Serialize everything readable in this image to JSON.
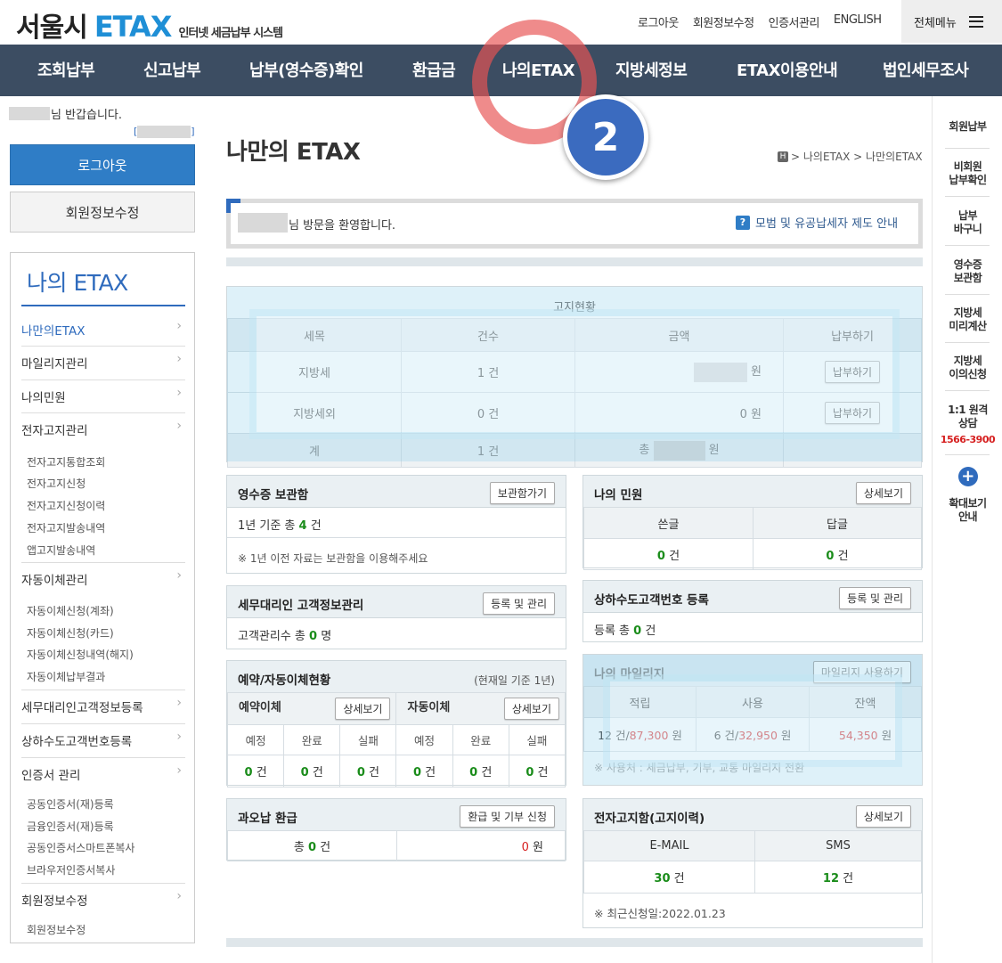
{
  "header": {
    "logo_main": "서울시",
    "logo_brand": "ETAX",
    "logo_sub": "인터넷 세금납부 시스템",
    "util_links": [
      "로그아웃",
      "회원정보수정",
      "인증서관리",
      "ENGLISH"
    ],
    "all_menu": "전체메뉴"
  },
  "gnb": [
    "조회납부",
    "신고납부",
    "납부(영수증)확인",
    "환급금",
    "나의ETAX",
    "지방세정보",
    "ETAX이용안내",
    "법인세무조사"
  ],
  "annotation": {
    "step": "2"
  },
  "left": {
    "greeting": "님 반갑습니다.",
    "logout": "로그아웃",
    "edit_info": "회원정보수정",
    "nav_title": "나의 ETAX",
    "menu": {
      "m0": "나만의ETAX",
      "m1": "마일리지관리",
      "m2": "나의민원",
      "m3": "전자고지관리",
      "s3": [
        "전자고지통합조회",
        "전자고지신청",
        "전자고지신청이력",
        "전자고지발송내역",
        "앱고지발송내역"
      ],
      "m4": "자동이체관리",
      "s4": [
        "자동이체신청(계좌)",
        "자동이체신청(카드)",
        "자동이체신청내역(해지)",
        "자동이체납부결과"
      ],
      "m5": "세무대리인고객정보등록",
      "m6": "상하수도고객번호등록",
      "m7": "인증서 관리",
      "s7": [
        "공동인증서(재)등록",
        "금융인증서(재)등록",
        "공동인증서스마트폰복사",
        "브라우저인증서복사"
      ],
      "m8": "회원정보수정",
      "s8": [
        "회원정보수정"
      ]
    }
  },
  "rail": {
    "r0": "회원납부",
    "r1": "비회원\n납부확인",
    "r2": "납부\n바구니",
    "r3": "영수증\n보관함",
    "r4": "지방세\n미리계산",
    "r5": "지방세\n이의신청",
    "r6": "1:1 원격\n상담",
    "phone": "1566-3900",
    "plus": "+",
    "zoom": "확대보기\n안내"
  },
  "main": {
    "title": "나만의 ETAX",
    "breadcrumb_home": "H",
    "breadcrumb": "> 나의ETAX > 나만의ETAX",
    "welcome": "님 방문을 환영합니다.",
    "guide_link": "모범 및 유공납세자 제도 안내",
    "notice": {
      "caption": "고지현황",
      "headers": [
        "세목",
        "건수",
        "금액",
        "납부하기"
      ],
      "rows": [
        {
          "tax": "지방세",
          "count": "1 건",
          "amount": "",
          "won": "원",
          "pay": "납부하기"
        },
        {
          "tax": "지방세외",
          "count": "0 건",
          "amount": "0",
          "won": "원",
          "pay": "납부하기"
        }
      ],
      "total": {
        "label": "계",
        "count": "1 건",
        "prefix": "총",
        "won": "원"
      }
    },
    "receipt": {
      "title": "영수증 보관함",
      "btn": "보관함가기",
      "line1a": "1년 기준 총 ",
      "line1n": "4",
      "line1b": " 건",
      "note": "※ 1년 이전 자료는 보관함을 이용해주세요"
    },
    "civil": {
      "title": "나의 민원",
      "btn": "상세보기",
      "h1": "쓴글",
      "h2": "답글",
      "v1": "0",
      "v2": "0",
      "unit": "건"
    },
    "agent": {
      "title": "세무대리인 고객정보관리",
      "btn": "등록 및 관리",
      "line_a": "고객관리수 총 ",
      "line_n": "0",
      "line_b": " 명"
    },
    "water": {
      "title": "상하수도고객번호 등록",
      "btn": "등록 및 관리",
      "line_a": "등록 총 ",
      "line_n": "0",
      "line_b": " 건"
    },
    "auto": {
      "title": "예약/자동이체현황",
      "basis": "(현재일 기준 1년)",
      "res_title": "예약이체",
      "auto_title": "자동이체",
      "btn": "상세보기",
      "cols": [
        "예정",
        "완료",
        "실패",
        "예정",
        "완료",
        "실패"
      ],
      "vals": [
        "0",
        "0",
        "0",
        "0",
        "0",
        "0"
      ],
      "unit": "건"
    },
    "mileage": {
      "title": "나의 마일리지",
      "btn": "마일리지 사용하기",
      "h": [
        "적립",
        "사용",
        "잔액"
      ],
      "earn_cnt": "12",
      "earn_amt": "87,300",
      "use_cnt": "6",
      "use_amt": "32,950",
      "balance": "54,350",
      "cnt_unit": " 건/",
      "won": " 원",
      "note": "※ 사용처 : 세금납부, 기부, 교통 마일리지 전환"
    },
    "refund": {
      "title": "과오납 환급",
      "btn": "환급 및 기부 신청",
      "total": "총 ",
      "cnt": "0",
      "cnt_unit": " 건",
      "amt": "0",
      "won": " 원"
    },
    "enotice": {
      "title": "전자고지함(고지이력)",
      "btn": "상세보기",
      "h1": "E-MAIL",
      "h2": "SMS",
      "v1": "30",
      "v2": "12",
      "unit": " 건",
      "recent": "※ 최근신청일:2022.01.23"
    }
  }
}
